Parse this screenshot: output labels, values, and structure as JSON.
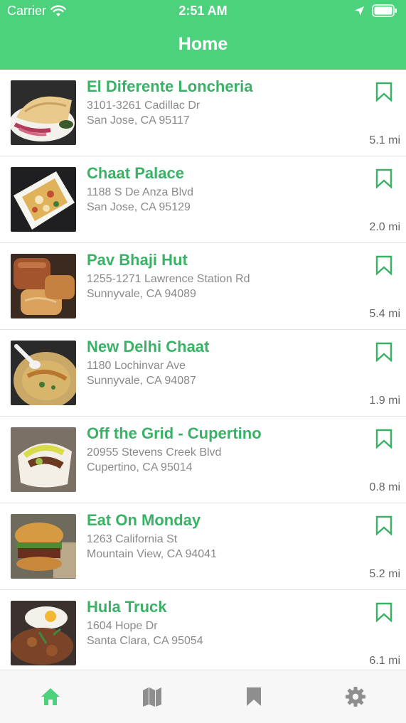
{
  "status": {
    "carrier": "Carrier",
    "time": "2:51 AM"
  },
  "nav": {
    "title": "Home"
  },
  "colors": {
    "brand": "#4cd17c",
    "title_green": "#39b266",
    "tab_active": "#4cd17c",
    "tab_inactive": "#8e8e8e"
  },
  "places": [
    {
      "name": "El Diferente Loncheria",
      "address1": "3101-3261 Cadillac Dr",
      "address2": "San Jose, CA 95117",
      "distance": "5.1 mi"
    },
    {
      "name": "Chaat Palace",
      "address1": "1188 S De Anza Blvd",
      "address2": "San Jose, CA 95129",
      "distance": "2.0 mi"
    },
    {
      "name": "Pav Bhaji Hut",
      "address1": "1255-1271 Lawrence Station Rd",
      "address2": "Sunnyvale, CA 94089",
      "distance": "5.4 mi"
    },
    {
      "name": "New Delhi Chaat",
      "address1": "1180 Lochinvar Ave",
      "address2": "Sunnyvale, CA 94087",
      "distance": "1.9 mi"
    },
    {
      "name": "Off the Grid - Cupertino",
      "address1": "20955 Stevens Creek Blvd",
      "address2": "Cupertino, CA 95014",
      "distance": "0.8 mi"
    },
    {
      "name": "Eat On Monday",
      "address1": "1263 California St",
      "address2": "Mountain View, CA 94041",
      "distance": "5.2 mi"
    },
    {
      "name": "Hula Truck",
      "address1": "1604 Hope Dr",
      "address2": "Santa Clara, CA 95054",
      "distance": "6.1 mi"
    }
  ],
  "tabs": [
    {
      "icon": "home-icon",
      "active": true
    },
    {
      "icon": "map-icon",
      "active": false
    },
    {
      "icon": "bookmark-icon",
      "active": false
    },
    {
      "icon": "gear-icon",
      "active": false
    }
  ]
}
